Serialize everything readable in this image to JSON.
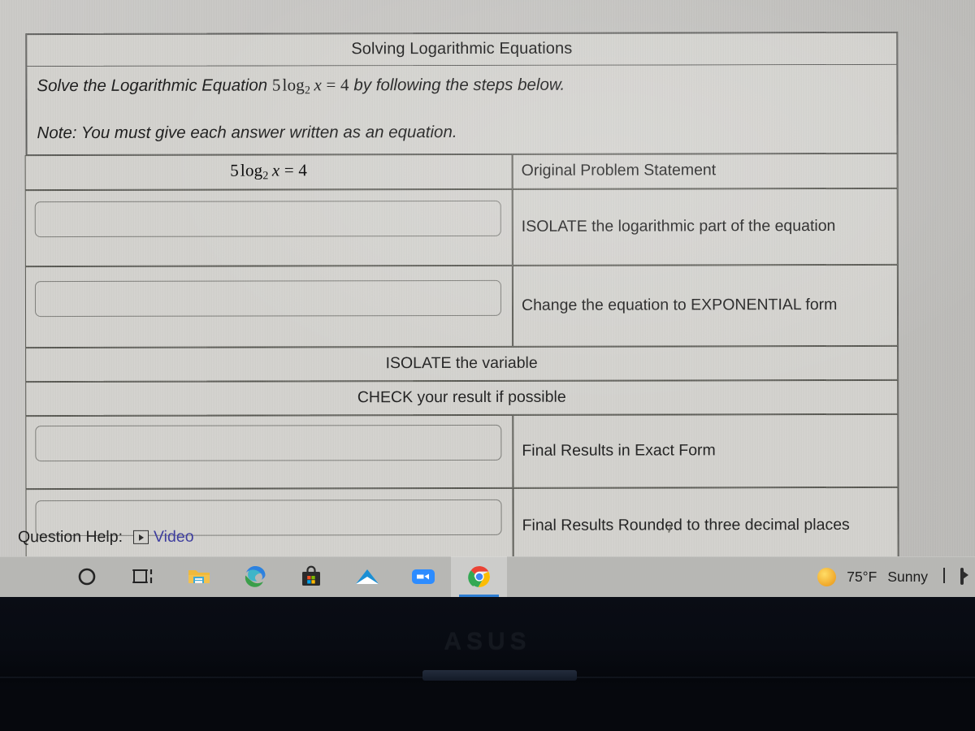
{
  "worksheet": {
    "title": "Solving Logarithmic Equations",
    "prompt_before": "Solve the Logarithmic Equation ",
    "equation_inline_coef": "5",
    "equation_inline_log": "log",
    "equation_inline_base": "2",
    "equation_inline_var": "x",
    "equation_inline_eq": "= 4",
    "prompt_after": " by following the steps below.",
    "note": "Note: You must give each answer written as an equation.",
    "original_equation_coef": "5",
    "original_equation_log": "log",
    "original_equation_base": "2",
    "original_equation_var": "x",
    "original_equation_rest": "= 4",
    "rows": [
      {
        "answer": "",
        "label": "Original Problem Statement"
      },
      {
        "answer": "",
        "label": "ISOLATE the logarithmic part of the equation"
      },
      {
        "answer": "",
        "label": "Change the equation to EXPONENTIAL form"
      },
      {
        "answer": "",
        "label": "Final Results in Exact Form"
      },
      {
        "answer": "",
        "label": "Final Results Rounded to three decimal places"
      }
    ],
    "full_width_rows": [
      "ISOLATE the variable",
      "CHECK your result if possible"
    ]
  },
  "question_help": {
    "label": "Question Help:",
    "video_label": "Video",
    "video_icon": "play-icon"
  },
  "taskbar": {
    "items": [
      {
        "name": "search-icon",
        "label": "Search"
      },
      {
        "name": "task-view-icon",
        "label": "Task View"
      },
      {
        "name": "file-explorer-icon",
        "label": "File Explorer"
      },
      {
        "name": "edge-icon",
        "label": "Microsoft Edge"
      },
      {
        "name": "microsoft-store-icon",
        "label": "Microsoft Store"
      },
      {
        "name": "mail-icon",
        "label": "Mail"
      },
      {
        "name": "zoom-icon",
        "label": "Zoom"
      },
      {
        "name": "chrome-icon",
        "label": "Google Chrome"
      }
    ],
    "weather_temp": "75°F",
    "weather_condition": "Sunny",
    "weather_icon": "sun-icon",
    "show_hidden_icon": "chevron-up-icon",
    "tray_camera_icon": "camera-icon"
  },
  "device": {
    "brand": "ASUS"
  },
  "colors": {
    "screen_bg": "#c4c3c0",
    "paper_bg": "#d2d1cd",
    "table_border": "#55554f",
    "text": "#1f1f1f",
    "link": "#3a3a9e",
    "taskbar_bg": "#b7b7b4",
    "active_indicator": "#2d7dd2",
    "bezel": "#080b12"
  }
}
